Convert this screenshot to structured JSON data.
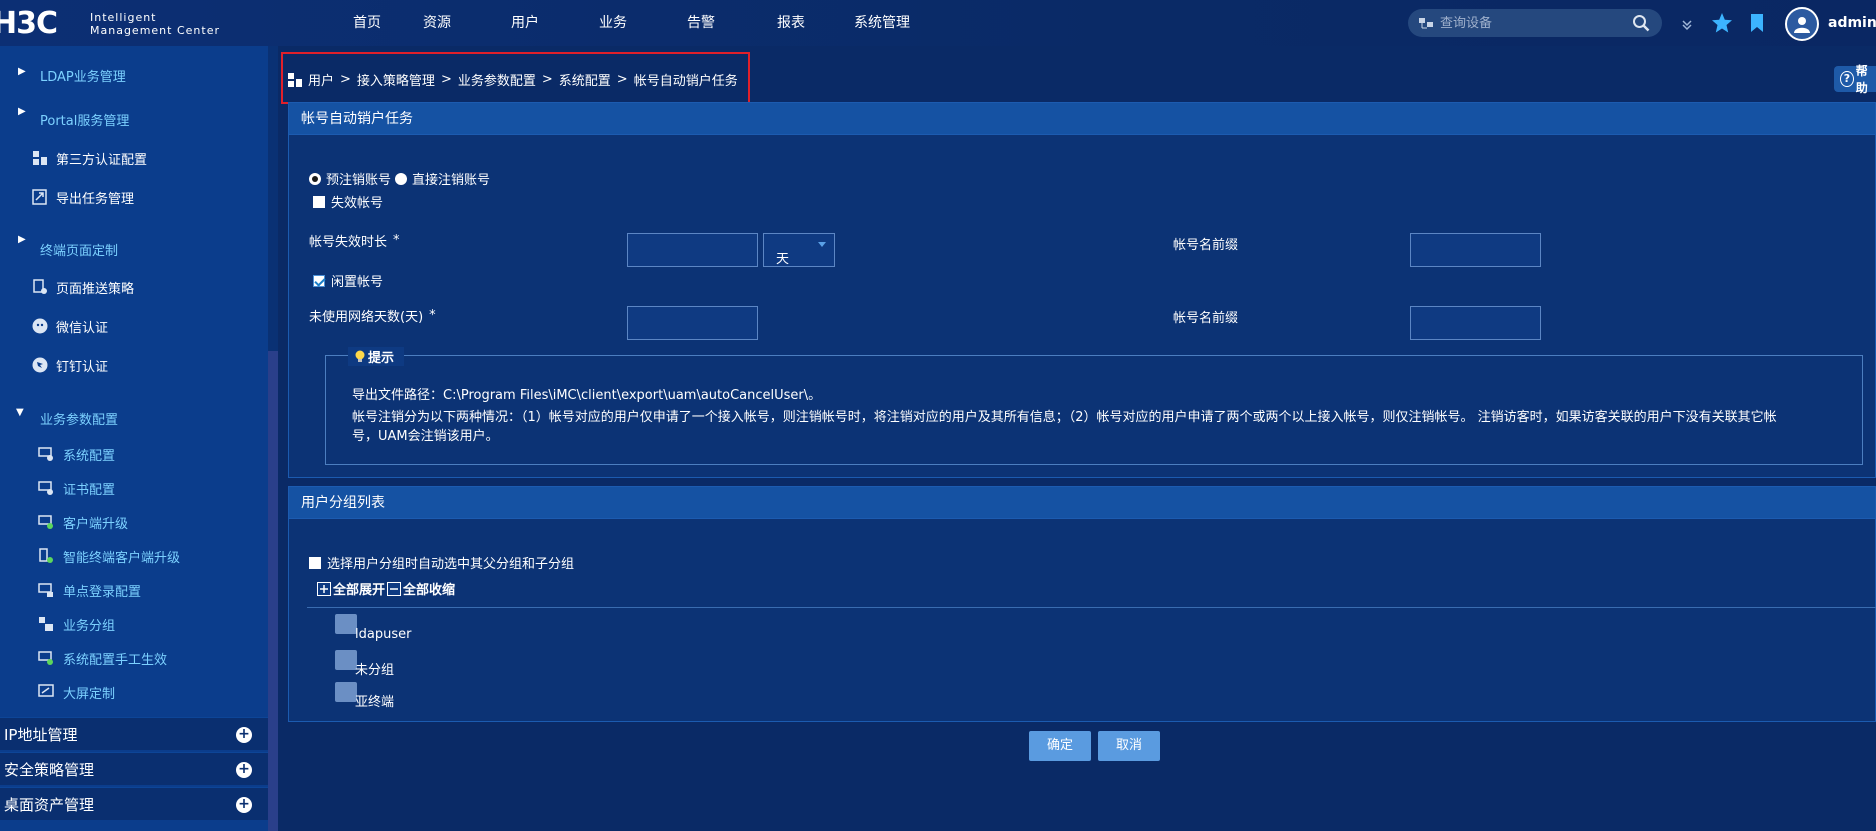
{
  "logo": {
    "mark": "H3C",
    "line1": "Intelligent",
    "line2": "Management Center"
  },
  "nav": [
    "首页",
    "资源",
    "用户",
    "业务",
    "告警",
    "报表",
    "系统管理"
  ],
  "search": {
    "placeholder": "查询设备"
  },
  "user": {
    "name": "admin"
  },
  "sidebar": {
    "items": [
      {
        "label": "LDAP业务管理",
        "type": "group"
      },
      {
        "label": "Portal服务管理",
        "type": "group"
      },
      {
        "label": "第三方认证配置",
        "type": "item"
      },
      {
        "label": "导出任务管理",
        "type": "item"
      },
      {
        "label": "终端页面定制",
        "type": "group"
      },
      {
        "label": "页面推送策略",
        "type": "item"
      },
      {
        "label": "微信认证",
        "type": "item"
      },
      {
        "label": "钉钉认证",
        "type": "item"
      },
      {
        "label": "业务参数配置",
        "type": "group-open"
      },
      {
        "label": "系统配置",
        "type": "sub"
      },
      {
        "label": "证书配置",
        "type": "sub"
      },
      {
        "label": "客户端升级",
        "type": "sub"
      },
      {
        "label": "智能终端客户端升级",
        "type": "sub"
      },
      {
        "label": "单点登录配置",
        "type": "sub"
      },
      {
        "label": "业务分组",
        "type": "sub"
      },
      {
        "label": "系统配置手工生效",
        "type": "sub"
      },
      {
        "label": "大屏定制",
        "type": "sub"
      }
    ],
    "sections": [
      "IP地址管理",
      "安全策略管理",
      "桌面资产管理"
    ]
  },
  "breadcrumb": [
    "用户",
    "接入策略管理",
    "业务参数配置",
    "系统配置",
    "帐号自动销户任务"
  ],
  "breadcrumb_sep": ">",
  "help": {
    "label": "帮助"
  },
  "task_panel": {
    "title": "帐号自动销户任务",
    "radio_pre": "预注销账号",
    "radio_direct": "直接注销账号",
    "expired_label": "失效帐号",
    "expire_duration_label": "帐号失效时长",
    "required_mark": "*",
    "expire_duration_value": "",
    "expire_unit": "天",
    "prefix_label_1": "帐号名前缀",
    "prefix_value_1": "",
    "idle_label": "闲置帐号",
    "idle_days_label": "未使用网络天数(天)",
    "idle_days_value": "",
    "prefix_label_2": "帐号名前缀",
    "prefix_value_2": "",
    "tip_title": "提示",
    "tip_line1": "导出文件路径：C:\\Program Files\\iMC\\client\\export\\uam\\autoCancelUser\\。",
    "tip_line2": "帐号注销分为以下两种情况：（1）帐号对应的用户仅申请了一个接入帐号，则注销帐号时，将注销对应的用户及其所有信息；（2）帐号对应的用户申请了两个或两个以上接入帐号，则仅注销帐号。 注销访客时，如果访客关联的用户下没有关联其它帐",
    "tip_line3": "号，UAM会注销该用户。"
  },
  "group_panel": {
    "title": "用户分组列表",
    "auto_select_label": "选择用户分组时自动选中其父分组和子分组",
    "expand_all": "全部展开",
    "collapse_all": "全部收缩",
    "nodes": [
      "ldapuser",
      "未分组",
      "亚终端"
    ]
  },
  "buttons": {
    "ok": "确定",
    "cancel": "取消"
  },
  "colors": {
    "accent": "#5a9be0",
    "highlight_border": "#e0202a",
    "sidebar_text": "#7cd1ff"
  }
}
